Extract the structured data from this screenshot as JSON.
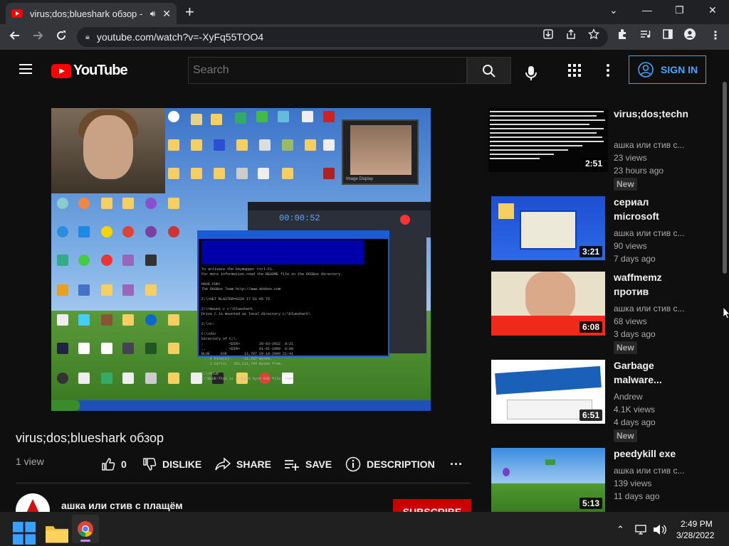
{
  "browser": {
    "tab_title": "virus;dos;blueshark обзор - Y",
    "tab_close": "✕",
    "new_tab": "+",
    "url": "youtube.com/watch?v=-XyFq55TOO4",
    "window_controls": [
      "⌄",
      "—",
      "❐",
      "✕"
    ]
  },
  "youtube": {
    "logo_text": "YouTube",
    "search_placeholder": "Search",
    "sign_in_label": "SIGN IN"
  },
  "video": {
    "title": "virus;dos;blueshark обзор",
    "views": "1 view",
    "like_count": "0",
    "dislike_label": "DISLIKE",
    "share_label": "SHARE",
    "save_label": "SAVE",
    "description_label": "DESCRIPTION",
    "more_label": "···",
    "channel_name": "ашка или стив с плащём",
    "subscribe_label": "SUBSCRIBE"
  },
  "player_content": {
    "bandicam_time": "00:00:52",
    "image_display_label": "Image Display",
    "dos_terminal": "To activate the keymapper ctrl-F1.\nFor more information read the README file in the DOSBox directory.\n\nHAVE FUN!\nThe DOSBox Team http://www.dosbox.com\n\nZ:\\>SET BLASTER=A220 I7 D1 H5 T6\n\nZ:\\>mount c c:\\blueshark\nDrive C is mounted as local directory c:\\blueshark\\\n\nZ:\\>c:\n\nC:\\>dir\nDirectory of C:\\.\n.            <DIR>         29-03-2022  0:21\n..           <DIR>         01-01-1980  0:00\nBLUE     EXE        11,787 29-10-2009 21:41\n    1 File(s)       11,787 Bytes.\n    2 Dir(s)   262,111,744 Bytes free.\n\nC:\\>blue\nC:\\BLUE~This is a 10000 byte EXE file. 1994"
  },
  "recommendations": [
    {
      "title": "virus;dos;techno clean версия",
      "channel": "ашка или стив с...",
      "views": "23 views",
      "age": "23 hours ago",
      "badge": "New",
      "duration": "2:51"
    },
    {
      "title": "сериал microsoft agent",
      "channel": "ашка или стив с...",
      "views": "90 views",
      "age": "7 days ago",
      "badge": "",
      "duration": "3:21"
    },
    {
      "title": "waffmemz против memz...",
      "channel": "ашка или стив с...",
      "views": "68 views",
      "age": "3 days ago",
      "badge": "New",
      "duration": "6:08"
    },
    {
      "title": "Garbage malware...",
      "channel": "Andrew",
      "views": "4.1K views",
      "age": "4 days ago",
      "badge": "New",
      "duration": "6:51"
    },
    {
      "title": "peedykill exe",
      "channel": "ашка или стив с...",
      "views": "139 views",
      "age": "11 days ago",
      "badge": "",
      "duration": "5:13"
    }
  ],
  "taskbar": {
    "time": "2:49 PM",
    "date": "3/28/2022"
  },
  "colors": {
    "accent_blue": "#3ea6ff",
    "youtube_red": "#ff0000",
    "subscribe_red": "#cc0000",
    "background": "#0f0f0f"
  }
}
